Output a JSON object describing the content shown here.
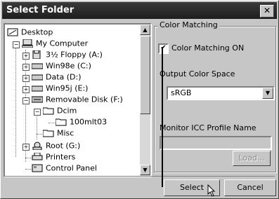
{
  "window": {
    "title": "Select Folder",
    "close_glyph": "✕"
  },
  "tree": {
    "items": [
      {
        "label": "Desktop",
        "icon": "desktop-icon"
      },
      {
        "label": "My Computer",
        "icon": "computer-icon"
      },
      {
        "label": "3½ Floppy (A:)",
        "icon": "floppy-icon"
      },
      {
        "label": "Win98e (C:)",
        "icon": "drive-icon"
      },
      {
        "label": "Data (D:)",
        "icon": "drive-icon"
      },
      {
        "label": "Win95j (E:)",
        "icon": "drive-icon"
      },
      {
        "label": "Removable Disk (F:)",
        "icon": "removable-disk-icon"
      },
      {
        "label": "Dcim",
        "icon": "folder-icon"
      },
      {
        "label": "100mlt03",
        "icon": "folder-icon"
      },
      {
        "label": "Misc",
        "icon": "folder-icon"
      },
      {
        "label": "Root (G:)",
        "icon": "network-drive-icon"
      },
      {
        "label": "Printers",
        "icon": "printers-icon"
      },
      {
        "label": "Control Panel",
        "icon": "control-panel-icon"
      }
    ]
  },
  "color_matching": {
    "group_title": "Color Matching",
    "checkbox_label": "Color Matching ON",
    "checked": true,
    "output_space_label": "Output Color Space",
    "output_space_value": "sRGB",
    "monitor_profile_label": "Monitor ICC Profile Name",
    "monitor_profile_value": "",
    "load_label": "Load..."
  },
  "buttons": {
    "select": "Select",
    "cancel": "Cancel"
  }
}
